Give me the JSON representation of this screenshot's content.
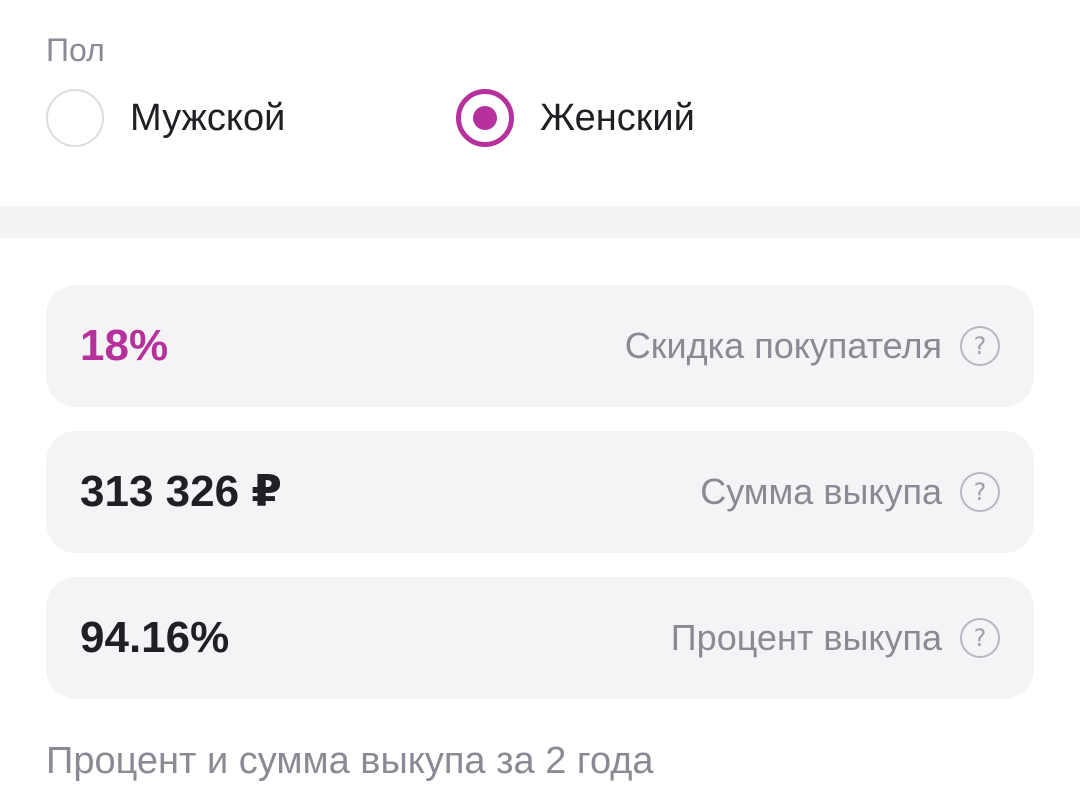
{
  "gender": {
    "label": "Пол",
    "options": [
      {
        "label": "Мужской",
        "selected": false
      },
      {
        "label": "Женский",
        "selected": true
      }
    ]
  },
  "stats": [
    {
      "value": "18%",
      "label": "Скидка покупателя",
      "help_icon": "question-circle-icon",
      "value_color": "#b6319c"
    },
    {
      "value": "313 326 ₽",
      "label": "Сумма выкупа",
      "help_icon": "question-circle-icon"
    },
    {
      "value": "94.16%",
      "label": "Процент выкупа",
      "help_icon": "question-circle-icon"
    }
  ],
  "footer": {
    "text": "Процент и сумма выкупа за 2 года"
  },
  "colors": {
    "accent": "#b6319c",
    "card_bg": "#f4f4f7",
    "muted_text": "#8a8a94"
  },
  "help_glyph": "?"
}
